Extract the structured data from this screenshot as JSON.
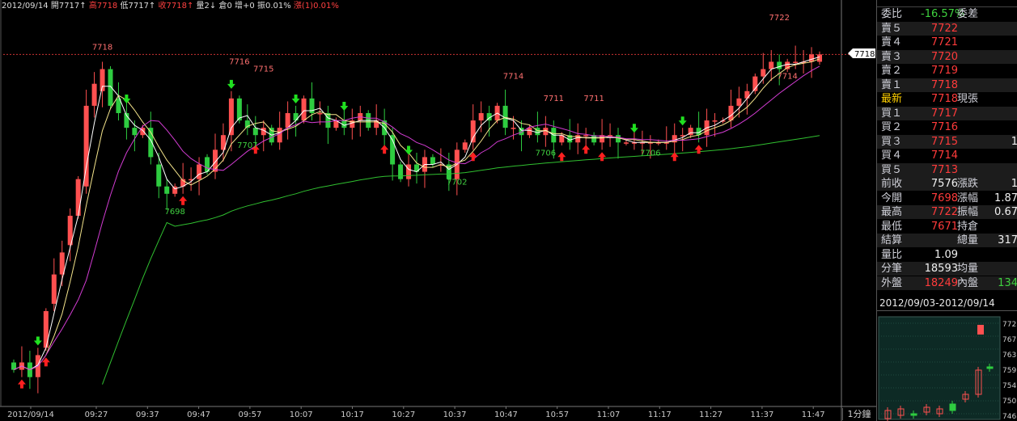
{
  "info_bar": {
    "date": "2012/09/14",
    "open_label": "開7717↑",
    "high_label": "高7718",
    "low_label": "低7717↑",
    "close_label": "收7718↑",
    "volume_label": "量2↓",
    "position_label": "倉0",
    "increase_label": "增+0",
    "amplitude_label": "振0.01%",
    "change_label": "漲(1)0.01%"
  },
  "chart_data": {
    "type": "candlestick",
    "x_tick_labels": [
      "2012/09/14",
      "09:27",
      "09:37",
      "09:47",
      "09:57",
      "10:07",
      "10:17",
      "10:27",
      "10:37",
      "10:47",
      "10:57",
      "11:07",
      "11:17",
      "11:27",
      "11:37",
      "11:47"
    ],
    "price_range": [
      7670,
      7723
    ],
    "reference_price": 7718,
    "annotations": [
      {
        "text": "7718",
        "x_index": 11,
        "price": 7718
      },
      {
        "text": "7716",
        "x_index": 28,
        "price": 7716
      },
      {
        "text": "7715",
        "x_index": 31,
        "price": 7715
      },
      {
        "text": "7698",
        "x_index": 20,
        "price": 7698
      },
      {
        "text": "7707",
        "x_index": 29,
        "price": 7707
      },
      {
        "text": "7714",
        "x_index": 62,
        "price": 7714
      },
      {
        "text": "7711",
        "x_index": 67,
        "price": 7711
      },
      {
        "text": "7711",
        "x_index": 72,
        "price": 7711
      },
      {
        "text": "7702",
        "x_index": 55,
        "price": 7702
      },
      {
        "text": "7706",
        "x_index": 66,
        "price": 7706
      },
      {
        "text": "7706",
        "x_index": 79,
        "price": 7706
      },
      {
        "text": "7722",
        "x_index": 95,
        "price": 7722
      },
      {
        "text": "7714",
        "x_index": 96,
        "price": 7714
      }
    ],
    "series": [
      {
        "name": "",
        "type": "candles",
        "open": [
          7676,
          7675,
          7676,
          7674,
          7678,
          7684,
          7688,
          7692,
          7696,
          7700,
          7711,
          7713,
          7716,
          7712,
          7710,
          7708,
          7707,
          7708,
          7703,
          7700,
          7699,
          7700,
          7701,
          7701,
          7704,
          7702,
          7705,
          7707,
          7712,
          7709,
          7708,
          7707,
          7708,
          7706,
          7708,
          7710,
          7709,
          7712,
          7710,
          7710,
          7708,
          7709,
          7708,
          7709,
          7710,
          7708,
          7709,
          7707,
          7703,
          7701,
          7703,
          7702,
          7704,
          7703,
          7703,
          7701,
          7705,
          7706,
          7709,
          7710,
          7709,
          7711,
          7708,
          7708,
          7707,
          7708,
          7707,
          7708,
          7706,
          7707,
          7706,
          7707,
          7707,
          7706,
          7707,
          7707,
          7706,
          7706,
          7706,
          7706,
          7706,
          7706,
          7706,
          7707,
          7707,
          7708,
          7707,
          7709,
          7709,
          7709,
          7711,
          7712,
          7713,
          7715,
          7716,
          7717,
          7716,
          7717,
          7717,
          7717,
          7717
        ],
        "close": [
          7675,
          7676,
          7674,
          7677,
          7683,
          7688,
          7691,
          7696,
          7701,
          7711,
          7714,
          7716,
          7711,
          7710,
          7708,
          7707,
          7708,
          7704,
          7700,
          7699,
          7700,
          7701,
          7701,
          7703,
          7702,
          7705,
          7707,
          7712,
          7709,
          7708,
          7707,
          7708,
          7706,
          7708,
          7710,
          7709,
          7712,
          7710,
          7710,
          7708,
          7709,
          7708,
          7709,
          7710,
          7708,
          7709,
          7707,
          7703,
          7701,
          7703,
          7702,
          7704,
          7703,
          7703,
          7701,
          7705,
          7706,
          7709,
          7710,
          7709,
          7711,
          7708,
          7708,
          7707,
          7708,
          7707,
          7708,
          7706,
          7707,
          7706,
          7707,
          7707,
          7706,
          7707,
          7707,
          7706,
          7706,
          7706,
          7706,
          7706,
          7706,
          7706,
          7707,
          7707,
          7708,
          7707,
          7709,
          7709,
          7709,
          7711,
          7712,
          7713,
          7715,
          7716,
          7717,
          7716,
          7717,
          7717,
          7717,
          7718,
          7718
        ]
      },
      {
        "name": "",
        "type": "line",
        "color": "#ffffff"
      },
      {
        "name": "",
        "type": "line",
        "color": "#f5e58c"
      },
      {
        "name": "",
        "type": "line",
        "color": "#d23cd2"
      },
      {
        "name": "",
        "type": "line",
        "color": "#30c030"
      }
    ],
    "buy_signal_indices": [
      1,
      4,
      21,
      30,
      46,
      57,
      68,
      71,
      73,
      82,
      85
    ],
    "sell_signal_indices": [
      3,
      14,
      27,
      35,
      41,
      49,
      77,
      83
    ],
    "grid": false
  },
  "quote": {
    "ratio_label": "委比",
    "ratio_value": "-16.57%",
    "diff_label": "委差",
    "asks": [
      {
        "label": "賣５",
        "price": "7722"
      },
      {
        "label": "賣４",
        "price": "7721"
      },
      {
        "label": "賣３",
        "price": "7720"
      },
      {
        "label": "賣２",
        "price": "7719"
      },
      {
        "label": "賣１",
        "price": "7718"
      }
    ],
    "last_label": "最新",
    "last_price": "7718",
    "last_side_label": "現張",
    "bids": [
      {
        "label": "買１",
        "price": "7717",
        "extra": ""
      },
      {
        "label": "買２",
        "price": "7716",
        "extra": ""
      },
      {
        "label": "買３",
        "price": "7715",
        "extra": "1"
      },
      {
        "label": "買４",
        "price": "7714",
        "extra": ""
      },
      {
        "label": "買５",
        "price": "7713",
        "extra": ""
      }
    ],
    "stats": [
      {
        "l1": "前收",
        "v1": "7576",
        "c1": "white",
        "l2": "漲跌",
        "v2": "1"
      },
      {
        "l1": "今開",
        "v1": "7698",
        "c1": "red",
        "l2": "漲幅",
        "v2": "1.87"
      },
      {
        "l1": "最高",
        "v1": "7722",
        "c1": "red",
        "l2": "振幅",
        "v2": "0.67"
      },
      {
        "l1": "最低",
        "v1": "7671",
        "c1": "red",
        "l2": "持倉",
        "v2": ""
      },
      {
        "l1": "結算",
        "v1": "",
        "c1": "white",
        "l2": "總量",
        "v2": "317"
      },
      {
        "l1": "量比",
        "v1": "1.09",
        "c1": "white",
        "l2": "",
        "v2": ""
      },
      {
        "l1": "分筆",
        "v1": "18593",
        "c1": "white",
        "l2": "均量",
        "v2": ""
      }
    ],
    "outer_label": "外盤",
    "outer_value": "18249",
    "inner_label": "內盤",
    "inner_value": "134",
    "range_label": "2012/09/03-2012/09/14",
    "price_tag": "7718",
    "mini_axis": [
      "772",
      "767",
      "763",
      "759",
      "754",
      "750",
      "746"
    ]
  },
  "interval_label": "1分鐘",
  "colors": {
    "up": "#ff5050",
    "down": "#2ecc40",
    "ma_white": "#ffffff",
    "ma_yellow": "#f5e58c",
    "ma_purple": "#d23cd2",
    "ma_green": "#30c030"
  }
}
